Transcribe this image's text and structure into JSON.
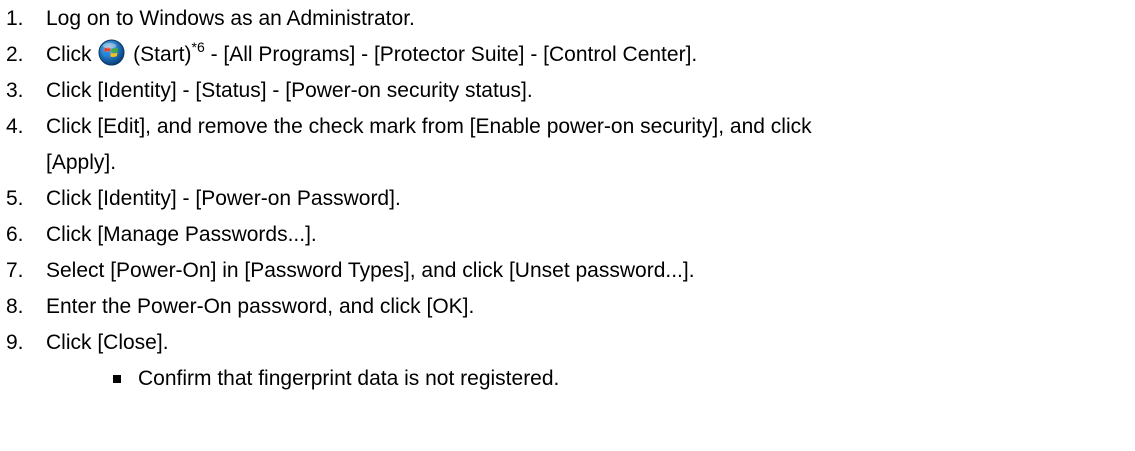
{
  "steps": [
    {
      "num": "1.",
      "text": "Log on to Windows as an Administrator."
    },
    {
      "num": "2.",
      "pre": "Click",
      "icon": "windows-start-orb-icon",
      "mid": " (Start)",
      "sup": "*6",
      "post": " - [All Programs] - [Protector Suite] - [Control Center]."
    },
    {
      "num": "3.",
      "text": "Click [Identity] - [Status] - [Power-on security status]."
    },
    {
      "num": "4.",
      "text": "Click [Edit], and remove the check mark from [Enable power-on security], and click",
      "text2": "[Apply]."
    },
    {
      "num": "5.",
      "text": "Click [Identity] - [Power-on Password]."
    },
    {
      "num": "6.",
      "text": "Click [Manage Passwords...]."
    },
    {
      "num": "7.",
      "text": "Select [Power-On] in [Password Types], and click [Unset password...]."
    },
    {
      "num": "8.",
      "text": "Enter the Power-On password, and click [OK]."
    },
    {
      "num": "9.",
      "text": "Click [Close]."
    }
  ],
  "bullets": [
    {
      "text": "Confirm that fingerprint data is not registered."
    }
  ],
  "colors": {
    "text": "#000000",
    "background": "#ffffff",
    "start_orb_blue": "#1f6fb8",
    "start_orb_red": "#e8422f",
    "start_orb_green": "#3fae3a",
    "start_orb_yellow": "#f5c21b"
  }
}
